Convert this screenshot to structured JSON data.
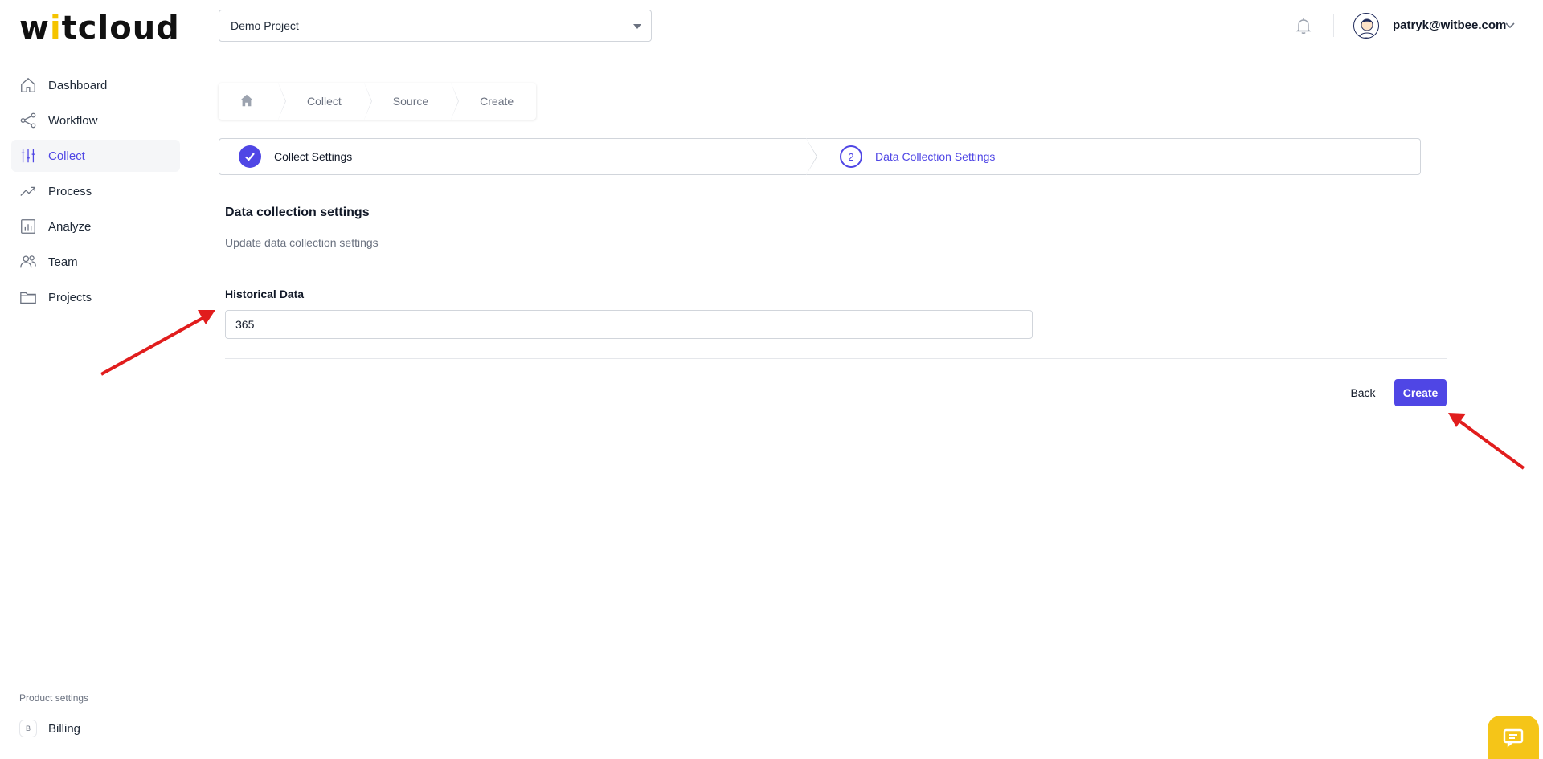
{
  "app": {
    "logo_text": "witcloud"
  },
  "sidebar": {
    "items": [
      {
        "label": "Dashboard",
        "icon": "home-icon"
      },
      {
        "label": "Workflow",
        "icon": "share-nodes-icon"
      },
      {
        "label": "Collect",
        "icon": "sliders-icon",
        "active": true
      },
      {
        "label": "Process",
        "icon": "trending-up-icon"
      },
      {
        "label": "Analyze",
        "icon": "bar-chart-icon"
      },
      {
        "label": "Team",
        "icon": "users-icon"
      },
      {
        "label": "Projects",
        "icon": "folder-icon"
      }
    ],
    "section_label": "Product settings",
    "billing": {
      "badge": "B",
      "label": "Billing"
    }
  },
  "header": {
    "project": "Demo Project",
    "user_email": "patryk@witbee.com"
  },
  "breadcrumb": {
    "items": [
      "Collect",
      "Source",
      "Create"
    ]
  },
  "stepper": {
    "step1": {
      "label": "Collect Settings",
      "status": "completed"
    },
    "step2": {
      "number": "2",
      "label": "Data Collection Settings",
      "status": "current"
    }
  },
  "form": {
    "title": "Data collection settings",
    "description": "Update data collection settings",
    "historical_label": "Historical Data",
    "historical_value": "365",
    "back_label": "Back",
    "create_label": "Create"
  },
  "colors": {
    "accent": "#4f46e5",
    "annotation": "#e11d1d",
    "chat": "#f5c518"
  }
}
